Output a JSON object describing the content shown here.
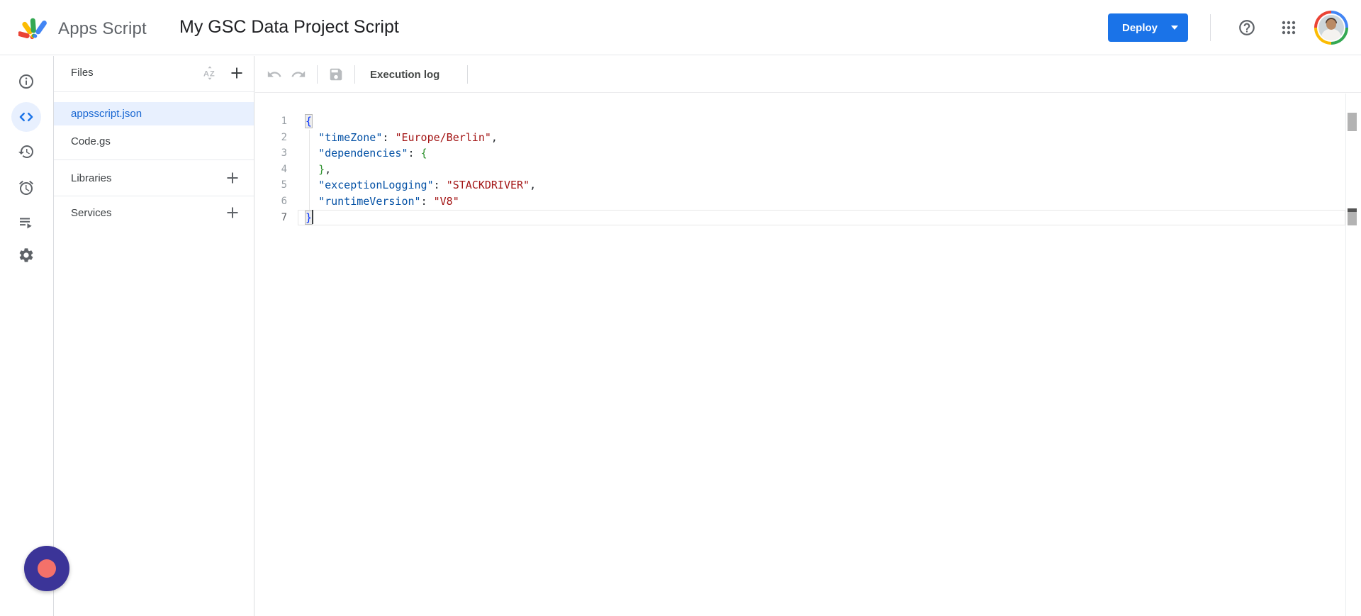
{
  "header": {
    "product_name": "Apps Script",
    "project_title": "My GSC Data Project Script",
    "deploy_button": "Deploy",
    "icons": [
      "apps-script-logo",
      "deploy-dropdown-caret",
      "help-icon",
      "google-apps-grid-icon",
      "account-avatar"
    ]
  },
  "nav_rail": {
    "items": [
      {
        "name": "overview",
        "icon": "info-icon",
        "selected": false
      },
      {
        "name": "editor",
        "icon": "code-icon",
        "selected": true
      },
      {
        "name": "project-history",
        "icon": "history-icon",
        "selected": false
      },
      {
        "name": "triggers",
        "icon": "alarm-clock-icon",
        "selected": false
      },
      {
        "name": "executions",
        "icon": "executions-list-icon",
        "selected": false
      },
      {
        "name": "project-settings",
        "icon": "gear-icon",
        "selected": false
      }
    ]
  },
  "files_panel": {
    "title": "Files",
    "header_icons": [
      "sort-az-icon",
      "add-file-icon"
    ],
    "files": [
      {
        "name": "appsscript.json",
        "selected": true
      },
      {
        "name": "Code.gs",
        "selected": false
      }
    ],
    "sections": [
      {
        "label": "Libraries",
        "icon": "add-library-icon"
      },
      {
        "label": "Services",
        "icon": "add-service-icon"
      }
    ]
  },
  "toolbar": {
    "icons": [
      "undo-icon",
      "redo-icon",
      "save-icon"
    ],
    "execution_log_label": "Execution log"
  },
  "editor": {
    "language": "json",
    "lines": [
      {
        "num": 1,
        "current": false,
        "cursor": false,
        "tokens": [
          {
            "c": "b1 m",
            "t": "{"
          }
        ]
      },
      {
        "num": 2,
        "current": false,
        "cursor": false,
        "tokens": [
          {
            "c": "p",
            "t": "  "
          },
          {
            "c": "k",
            "t": "\"timeZone\""
          },
          {
            "c": "p",
            "t": ": "
          },
          {
            "c": "v",
            "t": "\"Europe/Berlin\""
          },
          {
            "c": "p",
            "t": ","
          }
        ]
      },
      {
        "num": 3,
        "current": false,
        "cursor": false,
        "tokens": [
          {
            "c": "p",
            "t": "  "
          },
          {
            "c": "k",
            "t": "\"dependencies\""
          },
          {
            "c": "p",
            "t": ": "
          },
          {
            "c": "b2",
            "t": "{"
          }
        ]
      },
      {
        "num": 4,
        "current": false,
        "cursor": false,
        "tokens": [
          {
            "c": "p",
            "t": "  "
          },
          {
            "c": "b2",
            "t": "}"
          },
          {
            "c": "p",
            "t": ","
          }
        ]
      },
      {
        "num": 5,
        "current": false,
        "cursor": false,
        "tokens": [
          {
            "c": "p",
            "t": "  "
          },
          {
            "c": "k",
            "t": "\"exceptionLogging\""
          },
          {
            "c": "p",
            "t": ": "
          },
          {
            "c": "v",
            "t": "\"STACKDRIVER\""
          },
          {
            "c": "p",
            "t": ","
          }
        ]
      },
      {
        "num": 6,
        "current": false,
        "cursor": false,
        "tokens": [
          {
            "c": "p",
            "t": "  "
          },
          {
            "c": "k",
            "t": "\"runtimeVersion\""
          },
          {
            "c": "p",
            "t": ": "
          },
          {
            "c": "v",
            "t": "\"V8\""
          }
        ]
      },
      {
        "num": 7,
        "current": true,
        "cursor": true,
        "tokens": [
          {
            "c": "b1 m",
            "t": "}"
          }
        ]
      }
    ]
  },
  "colors": {
    "accent_blue": "#1a73e8",
    "selected_file_bg": "#e8f0fe",
    "selected_file_text": "#1967d2",
    "token_key": "#0451a5",
    "token_string": "#a31515",
    "token_brace_level1": "#0431fa",
    "token_brace_level2": "#319331",
    "feedback_outer": "#3b3498",
    "feedback_inner": "#f4716a"
  },
  "feedback_widget": {
    "icon": "feedback-chat-button"
  }
}
